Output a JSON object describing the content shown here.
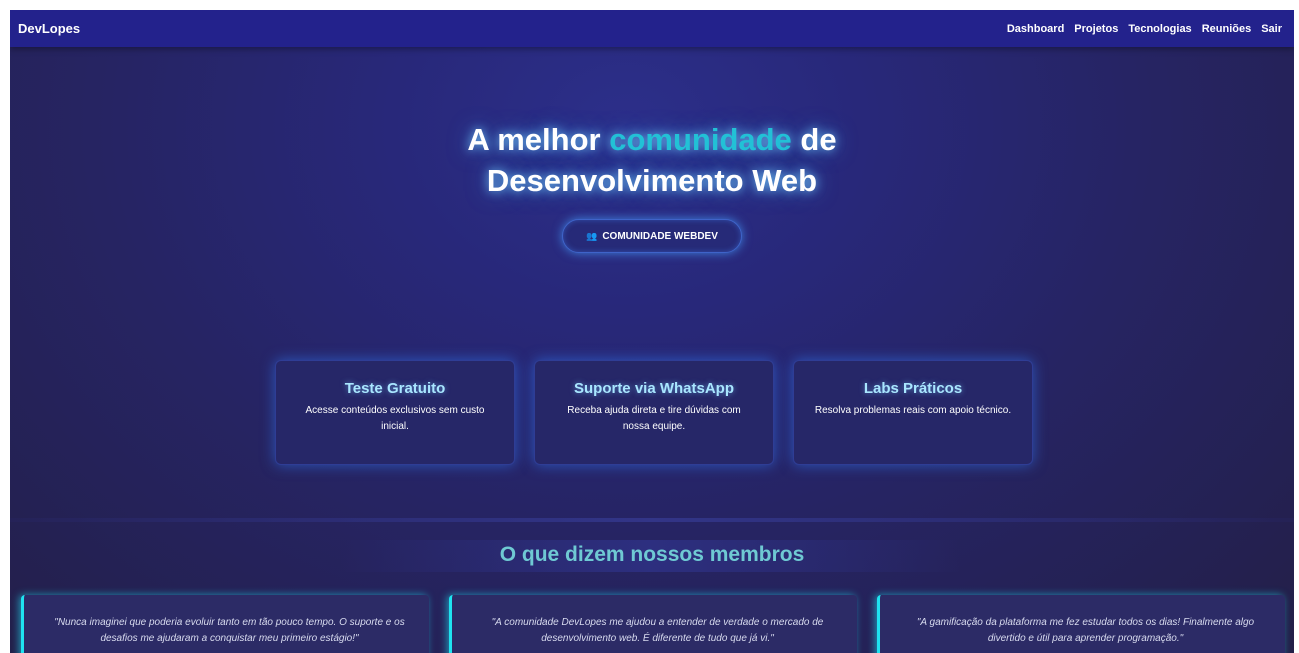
{
  "navbar": {
    "brand": "DevLopes",
    "links": [
      "Dashboard",
      "Projetos",
      "Tecnologias",
      "Reuniões",
      "Sair"
    ]
  },
  "hero": {
    "title_prefix": "A melhor ",
    "title_accent": "comunidade",
    "title_suffix": " de",
    "title_line2": "Desenvolvimento Web",
    "cta_icon": "people-icon",
    "cta_label": "COMUNIDADE WEBDEV"
  },
  "features": [
    {
      "title": "Teste Gratuito",
      "description": "Acesse conteúdos exclusivos sem custo inicial."
    },
    {
      "title": "Suporte via WhatsApp",
      "description": "Receba ajuda direta e tire dúvidas com nossa equipe."
    },
    {
      "title": "Labs Práticos",
      "description": "Resolva problemas reais com apoio técnico."
    }
  ],
  "testimonials": {
    "title": "O que dizem nossos membros",
    "items": [
      "\"Nunca imaginei que poderia evoluir tanto em tão pouco tempo. O suporte e os desafios me ajudaram a conquistar meu primeiro estágio!\"",
      "\"A comunidade DevLopes me ajudou a entender de verdade o mercado de desenvolvimento web. É diferente de tudo que já vi.\"",
      "\"A gamificação da plataforma me fez estudar todos os dias! Finalmente algo divertido e útil para aprender programação.\""
    ]
  },
  "colors": {
    "navbar": "#23228c",
    "accent": "#22c1d6",
    "testimonial_border": "#1fe3f0",
    "feature_title": "#a9e6ff"
  }
}
